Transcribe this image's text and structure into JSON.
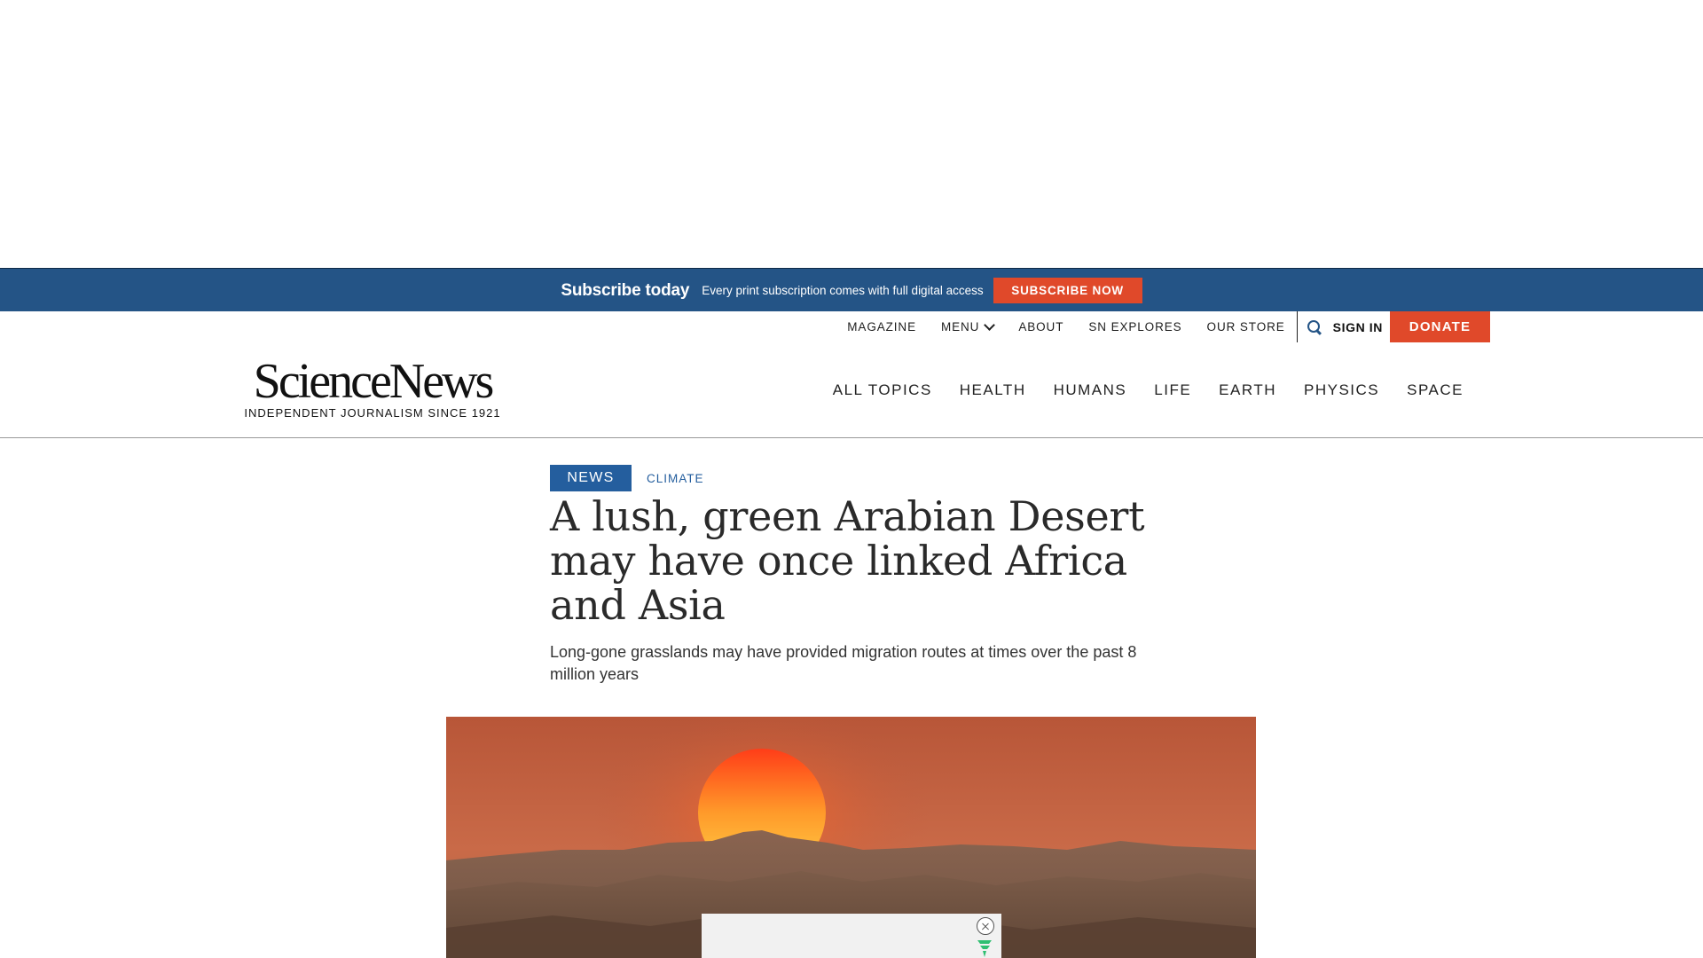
{
  "subscribe_banner": {
    "title": "Subscribe today",
    "text": "Every print subscription comes with full digital access",
    "button_label": "SUBSCRIBE NOW"
  },
  "utility_nav": {
    "items": [
      "MAGAZINE",
      "MENU",
      "ABOUT",
      "SN EXPLORES",
      "OUR STORE"
    ],
    "sign_in_label": "SIGN IN",
    "donate_label": "DONATE"
  },
  "masthead": {
    "logo_text": "ScienceNews",
    "tagline": "INDEPENDENT JOURNALISM SINCE 1921",
    "topics": [
      "ALL TOPICS",
      "HEALTH",
      "HUMANS",
      "LIFE",
      "EARTH",
      "PHYSICS",
      "SPACE"
    ]
  },
  "article": {
    "category_badge": "NEWS",
    "topic_link": "CLIMATE",
    "headline": "A lush, green Arabian Desert may have once linked Africa and Asia",
    "dek": "Long-gone grasslands may have provided migration routes at times over the past 8 million years"
  },
  "colors": {
    "brand_blue": "#245486",
    "accent_orange": "#e0492a",
    "badge_blue": "#245e9e"
  },
  "icons": {
    "search": "search-icon",
    "menu_chevron": "chevron-down-icon",
    "ad_close": "close-icon",
    "ad_network": "freestar-icon"
  }
}
